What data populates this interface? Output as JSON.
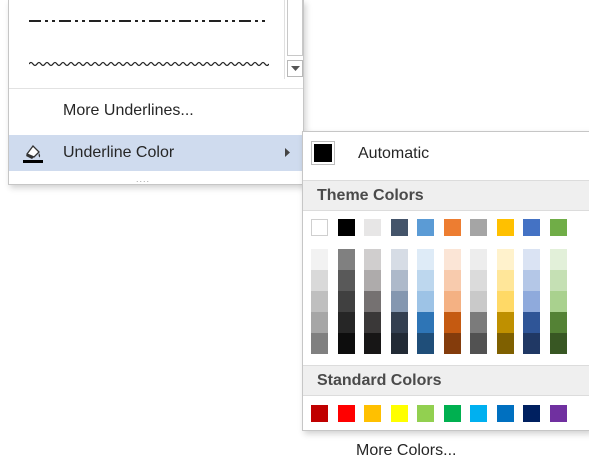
{
  "underline_menu": {
    "more_underlines_label": "More Underlines...",
    "underline_color_label": "Underline Color",
    "resize_grip": "...."
  },
  "color_palette": {
    "automatic_label": "Automatic",
    "automatic_color": "#000000",
    "theme_colors_header": "Theme Colors",
    "standard_colors_header": "Standard Colors",
    "more_colors_label": "More Colors...",
    "theme_base": [
      "#ffffff",
      "#000000",
      "#e7e6e6",
      "#44546a",
      "#5b9bd5",
      "#ed7d31",
      "#a5a5a5",
      "#ffc000",
      "#4472c4",
      "#70ad47"
    ],
    "theme_shades": [
      [
        "#f2f2f2",
        "#d9d9d9",
        "#bfbfbf",
        "#a6a6a6",
        "#808080"
      ],
      [
        "#808080",
        "#595959",
        "#404040",
        "#262626",
        "#0d0d0d"
      ],
      [
        "#d0cece",
        "#aeabab",
        "#757171",
        "#3a3838",
        "#171616"
      ],
      [
        "#d6dce5",
        "#adb9ca",
        "#8497b0",
        "#333f50",
        "#222a35"
      ],
      [
        "#deebf7",
        "#bdd7ee",
        "#9dc3e6",
        "#2e75b6",
        "#1f4e79"
      ],
      [
        "#fbe5d6",
        "#f8cbad",
        "#f4b183",
        "#c55a11",
        "#843c0c"
      ],
      [
        "#ededed",
        "#dbdbdb",
        "#c9c9c9",
        "#7b7b7b",
        "#525252"
      ],
      [
        "#fff2cc",
        "#ffe699",
        "#ffd966",
        "#bf9000",
        "#7f6000"
      ],
      [
        "#dae3f3",
        "#b4c7e7",
        "#8faadc",
        "#2f5597",
        "#203864"
      ],
      [
        "#e2f0d9",
        "#c5e0b4",
        "#a9d18e",
        "#548235",
        "#385723"
      ]
    ],
    "standard": [
      "#c00000",
      "#ff0000",
      "#ffc000",
      "#ffff00",
      "#92d050",
      "#00b050",
      "#00b0f0",
      "#0070c0",
      "#002060",
      "#7030a0"
    ]
  }
}
